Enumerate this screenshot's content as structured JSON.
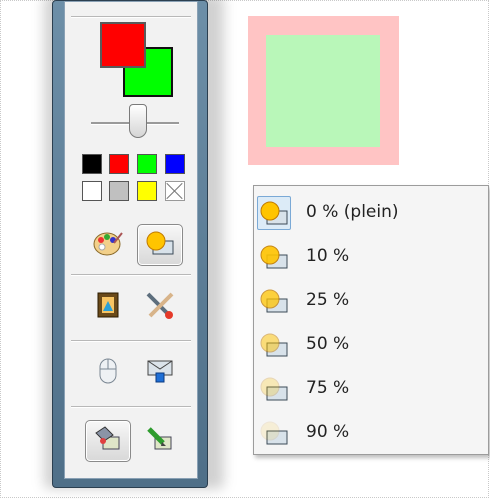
{
  "palette": {
    "foreground_color": "#ff0000",
    "background_color": "#00ff00",
    "swatches": [
      "#000000",
      "#ff0000",
      "#00ff00",
      "#0000ff",
      "#ffffff",
      "#c0c0c0",
      "#ffff00",
      "none"
    ],
    "opacity_slider_value": 0.6,
    "tools": [
      {
        "name": "palette-tool-icon",
        "active": false
      },
      {
        "name": "opacity-tool-icon",
        "active": true
      },
      {
        "name": "image-frame-icon",
        "active": false
      },
      {
        "name": "brush-pen-icon",
        "active": false
      },
      {
        "name": "mouse-icon",
        "active": false
      },
      {
        "name": "screen-stamp-icon",
        "active": false
      },
      {
        "name": "eraser-pick-icon",
        "active": true
      },
      {
        "name": "pencil-image-icon",
        "active": false
      }
    ]
  },
  "preview": {
    "outer_color": "#ffc4c4",
    "inner_color": "#b9f7b9"
  },
  "opacity_menu": {
    "items": [
      {
        "label": "0 % (plein)",
        "selected": true,
        "alpha": 1.0
      },
      {
        "label": "10 %",
        "selected": false,
        "alpha": 0.9
      },
      {
        "label": "25 %",
        "selected": false,
        "alpha": 0.75
      },
      {
        "label": "50 %",
        "selected": false,
        "alpha": 0.5
      },
      {
        "label": "75 %",
        "selected": false,
        "alpha": 0.25
      },
      {
        "label": "90 %",
        "selected": false,
        "alpha": 0.1
      }
    ]
  }
}
